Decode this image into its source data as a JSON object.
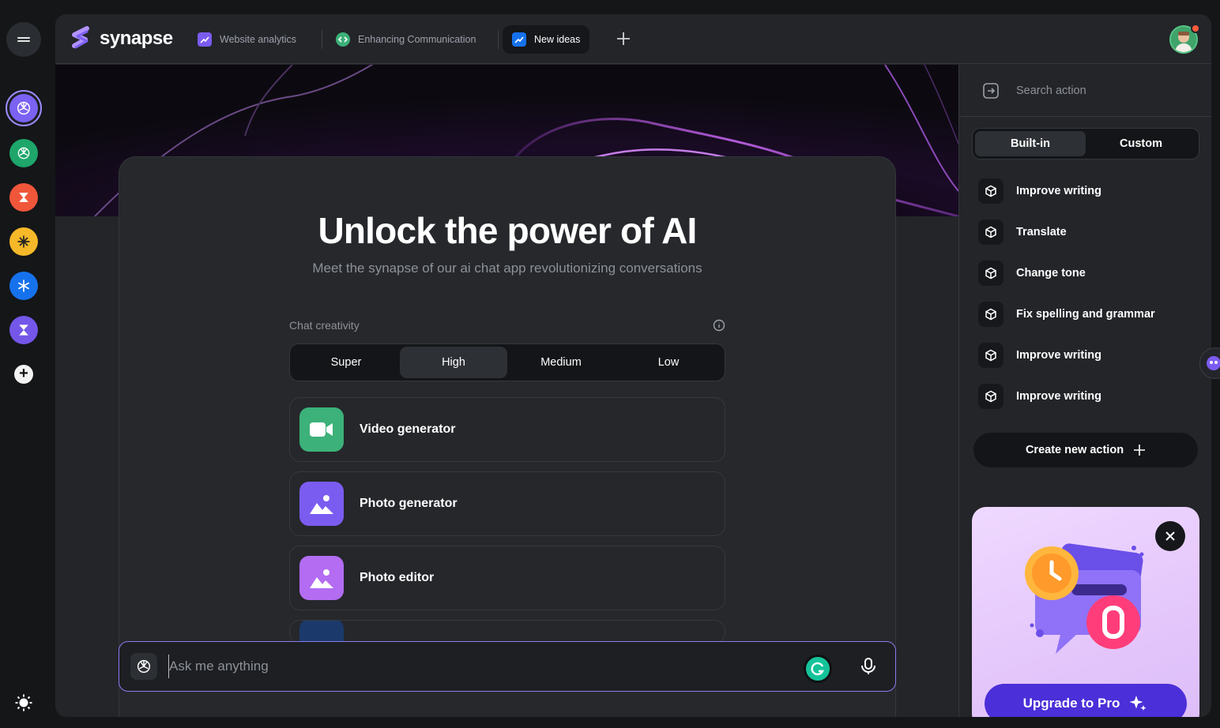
{
  "app": {
    "name": "synapse"
  },
  "tabs": [
    {
      "label": "Website analytics"
    },
    {
      "label": "Enhancing Communication"
    },
    {
      "label": "New ideas"
    }
  ],
  "rail": {
    "apps": [
      "openai-icon",
      "openai-icon",
      "bolt-app-icon",
      "sparkle-app-icon",
      "snowflake-app-icon",
      "hourglass-app-icon"
    ]
  },
  "hero": {
    "title": "Unlock the power of AI",
    "subtitle": "Meet the synapse of our ai chat app revolutionizing conversations"
  },
  "creativity": {
    "label": "Chat creativity",
    "options": [
      "Super",
      "High",
      "Medium",
      "Low"
    ],
    "selected": "High"
  },
  "tools": [
    {
      "label": "Video generator",
      "icon": "video-icon",
      "color": "#3cb179"
    },
    {
      "label": "Photo generator",
      "icon": "image-icon",
      "color": "#7b5cf0"
    },
    {
      "label": "Photo editor",
      "icon": "image-icon",
      "color": "#b36cf2"
    }
  ],
  "chat": {
    "placeholder": "Ask me anything"
  },
  "actions_panel": {
    "search_placeholder": "Search action",
    "segments": [
      "Built-in",
      "Custom"
    ],
    "selected_segment": "Built-in",
    "actions": [
      "Improve writing",
      "Translate",
      "Change tone",
      "Fix spelling and grammar",
      "Improve writing",
      "Improve writing"
    ],
    "create_label": "Create new action"
  },
  "promo": {
    "cta": "Upgrade to Pro"
  },
  "colors": {
    "accent": "#8b7bf0",
    "upgrade": "#4b2fd8",
    "frame": "#232529",
    "background": "#141618"
  }
}
